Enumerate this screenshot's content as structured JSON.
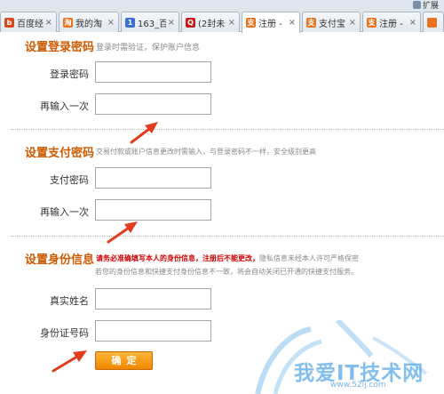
{
  "browser": {
    "extension_label": "扩展",
    "tabs": [
      {
        "label": "百度经",
        "icon_color": "#d64a1c",
        "icon_glyph": "b"
      },
      {
        "label": "我的淘",
        "icon_color": "#e8731e",
        "icon_glyph": "淘"
      },
      {
        "label": "163_百",
        "icon_color": "#3a6fd1",
        "icon_glyph": "1"
      },
      {
        "label": "(2封未",
        "icon_color": "#c41a1a",
        "icon_glyph": "Q"
      },
      {
        "label": "注册 - ",
        "icon_color": "#e8731e",
        "icon_glyph": "支",
        "active": true
      },
      {
        "label": "支付宝",
        "icon_color": "#e8731e",
        "icon_glyph": "支"
      },
      {
        "label": "注册 - ",
        "icon_color": "#e8731e",
        "icon_glyph": "支"
      }
    ],
    "close_glyph": "×"
  },
  "login_password": {
    "title": "设置登录密码",
    "hint": "登录时需验证，保护账户信息",
    "field1_label": "登录密码",
    "field1_value": "",
    "field2_label": "再输入一次",
    "field2_value": ""
  },
  "pay_password": {
    "title": "设置支付密码",
    "hint": "交易付款或账户信息更改时需输入，与登录密码不一样，安全级别更高",
    "field1_label": "支付密码",
    "field1_value": "",
    "field2_label": "再输入一次",
    "field2_value": ""
  },
  "identity": {
    "title": "设置身份信息",
    "hint_red": "请务必准确填写本人的身份信息，注册后不能更改，",
    "hint_gray": "隐私信息未经本人许可严格保密",
    "hint_line2": "若您的身份信息和快捷支付身份信息不一致，将会自动关闭已开通的快捷支付服务。",
    "name_label": "真实姓名",
    "name_value": "",
    "id_label": "身份证号码",
    "id_value": ""
  },
  "submit_label": "确定",
  "watermark": {
    "text": "我爱IT技术网",
    "url": "www.52ij.com"
  },
  "colors": {
    "section_title": "#cc5a00",
    "button": "#f08600",
    "arrow": "#e23b1f",
    "watermark": "#5aa9e6"
  }
}
